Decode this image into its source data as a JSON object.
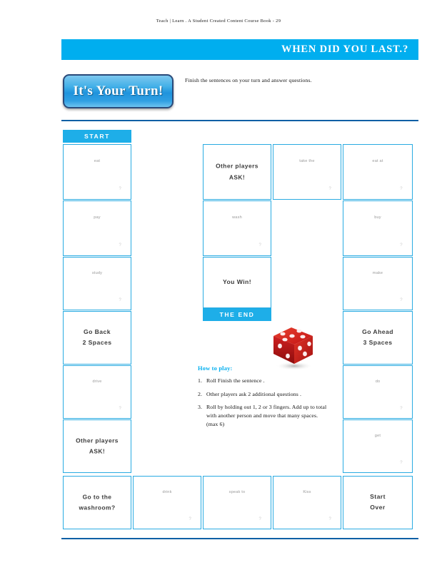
{
  "page": {
    "running_header": "Teach | Learn . A Student Created Content Course Book - 29",
    "title": "WHEN DID YOU LAST.?",
    "turn_button_label": "It's Your Turn!",
    "instruction": "Finish the sentences on your turn and answer questions."
  },
  "colors": {
    "accent_blue": "#00AEEF",
    "cell_border": "#29ABE2",
    "band_blue": "#1EAEE8",
    "rule_blue": "#0b5fa5",
    "dice_red": "#cc1f1f",
    "prompt_grey": "#9a9a9a"
  },
  "board": {
    "start_label": "START",
    "end_label": "THE END",
    "cells": [
      {
        "id": "c-eat",
        "kind": "prompt",
        "text": "eat",
        "qmark": "?"
      },
      {
        "id": "c-pay",
        "kind": "prompt",
        "text": "pay",
        "qmark": "?"
      },
      {
        "id": "c-study",
        "kind": "prompt",
        "text": "study",
        "qmark": "?"
      },
      {
        "id": "c-goback",
        "kind": "action",
        "line1": "Go Back",
        "line2": "2 Spaces"
      },
      {
        "id": "c-drive",
        "kind": "prompt",
        "text": "drive",
        "qmark": "?"
      },
      {
        "id": "c-ask-left",
        "kind": "action",
        "line1": "Other players",
        "line2": "ASK!"
      },
      {
        "id": "c-washroom",
        "kind": "action",
        "line1": "Go to the",
        "line2": "washroom?"
      },
      {
        "id": "c-drink",
        "kind": "prompt",
        "text": "drink",
        "qmark": "?"
      },
      {
        "id": "c-speakto",
        "kind": "prompt",
        "text": "speak to",
        "qmark": "?"
      },
      {
        "id": "c-kiss",
        "kind": "prompt",
        "text": "Kiss",
        "qmark": "?"
      },
      {
        "id": "c-startover",
        "kind": "action",
        "line1": "Start",
        "line2": "Over"
      },
      {
        "id": "c-get",
        "kind": "prompt",
        "text": "get",
        "qmark": "?"
      },
      {
        "id": "c-do",
        "kind": "prompt",
        "text": "do",
        "qmark": "?"
      },
      {
        "id": "c-goahead",
        "kind": "action",
        "line1": "Go Ahead",
        "line2": "3 Spaces"
      },
      {
        "id": "c-make",
        "kind": "prompt",
        "text": "make",
        "qmark": "?"
      },
      {
        "id": "c-buy",
        "kind": "prompt",
        "text": "buy",
        "qmark": "?"
      },
      {
        "id": "c-eatat",
        "kind": "prompt",
        "text": "eat at",
        "qmark": "?"
      },
      {
        "id": "c-takethe",
        "kind": "prompt",
        "text": "take the",
        "qmark": "?"
      },
      {
        "id": "c-wash",
        "kind": "prompt",
        "text": "wash",
        "qmark": "?"
      },
      {
        "id": "c-ask-mid",
        "kind": "action",
        "line1": "Other players",
        "line2": "ASK!"
      },
      {
        "id": "c-youwin",
        "kind": "action",
        "line1": "You Win!",
        "line2": ""
      }
    ]
  },
  "howto": {
    "title": "How to play:",
    "steps": [
      {
        "num": "1.",
        "text": "Roll Finish the sentence ."
      },
      {
        "num": "2.",
        "text": "Other players ask 2 additional questions ."
      },
      {
        "num": "3.",
        "text": "Roll by holding out 1, 2 or 3 fingers. Add up to total with another person and move that many spaces. (max 6)"
      }
    ]
  },
  "dice": {
    "top_face_pips": 5,
    "front_face_pips": 3,
    "side_face_pips": 2,
    "color": "#cc1f1f"
  }
}
